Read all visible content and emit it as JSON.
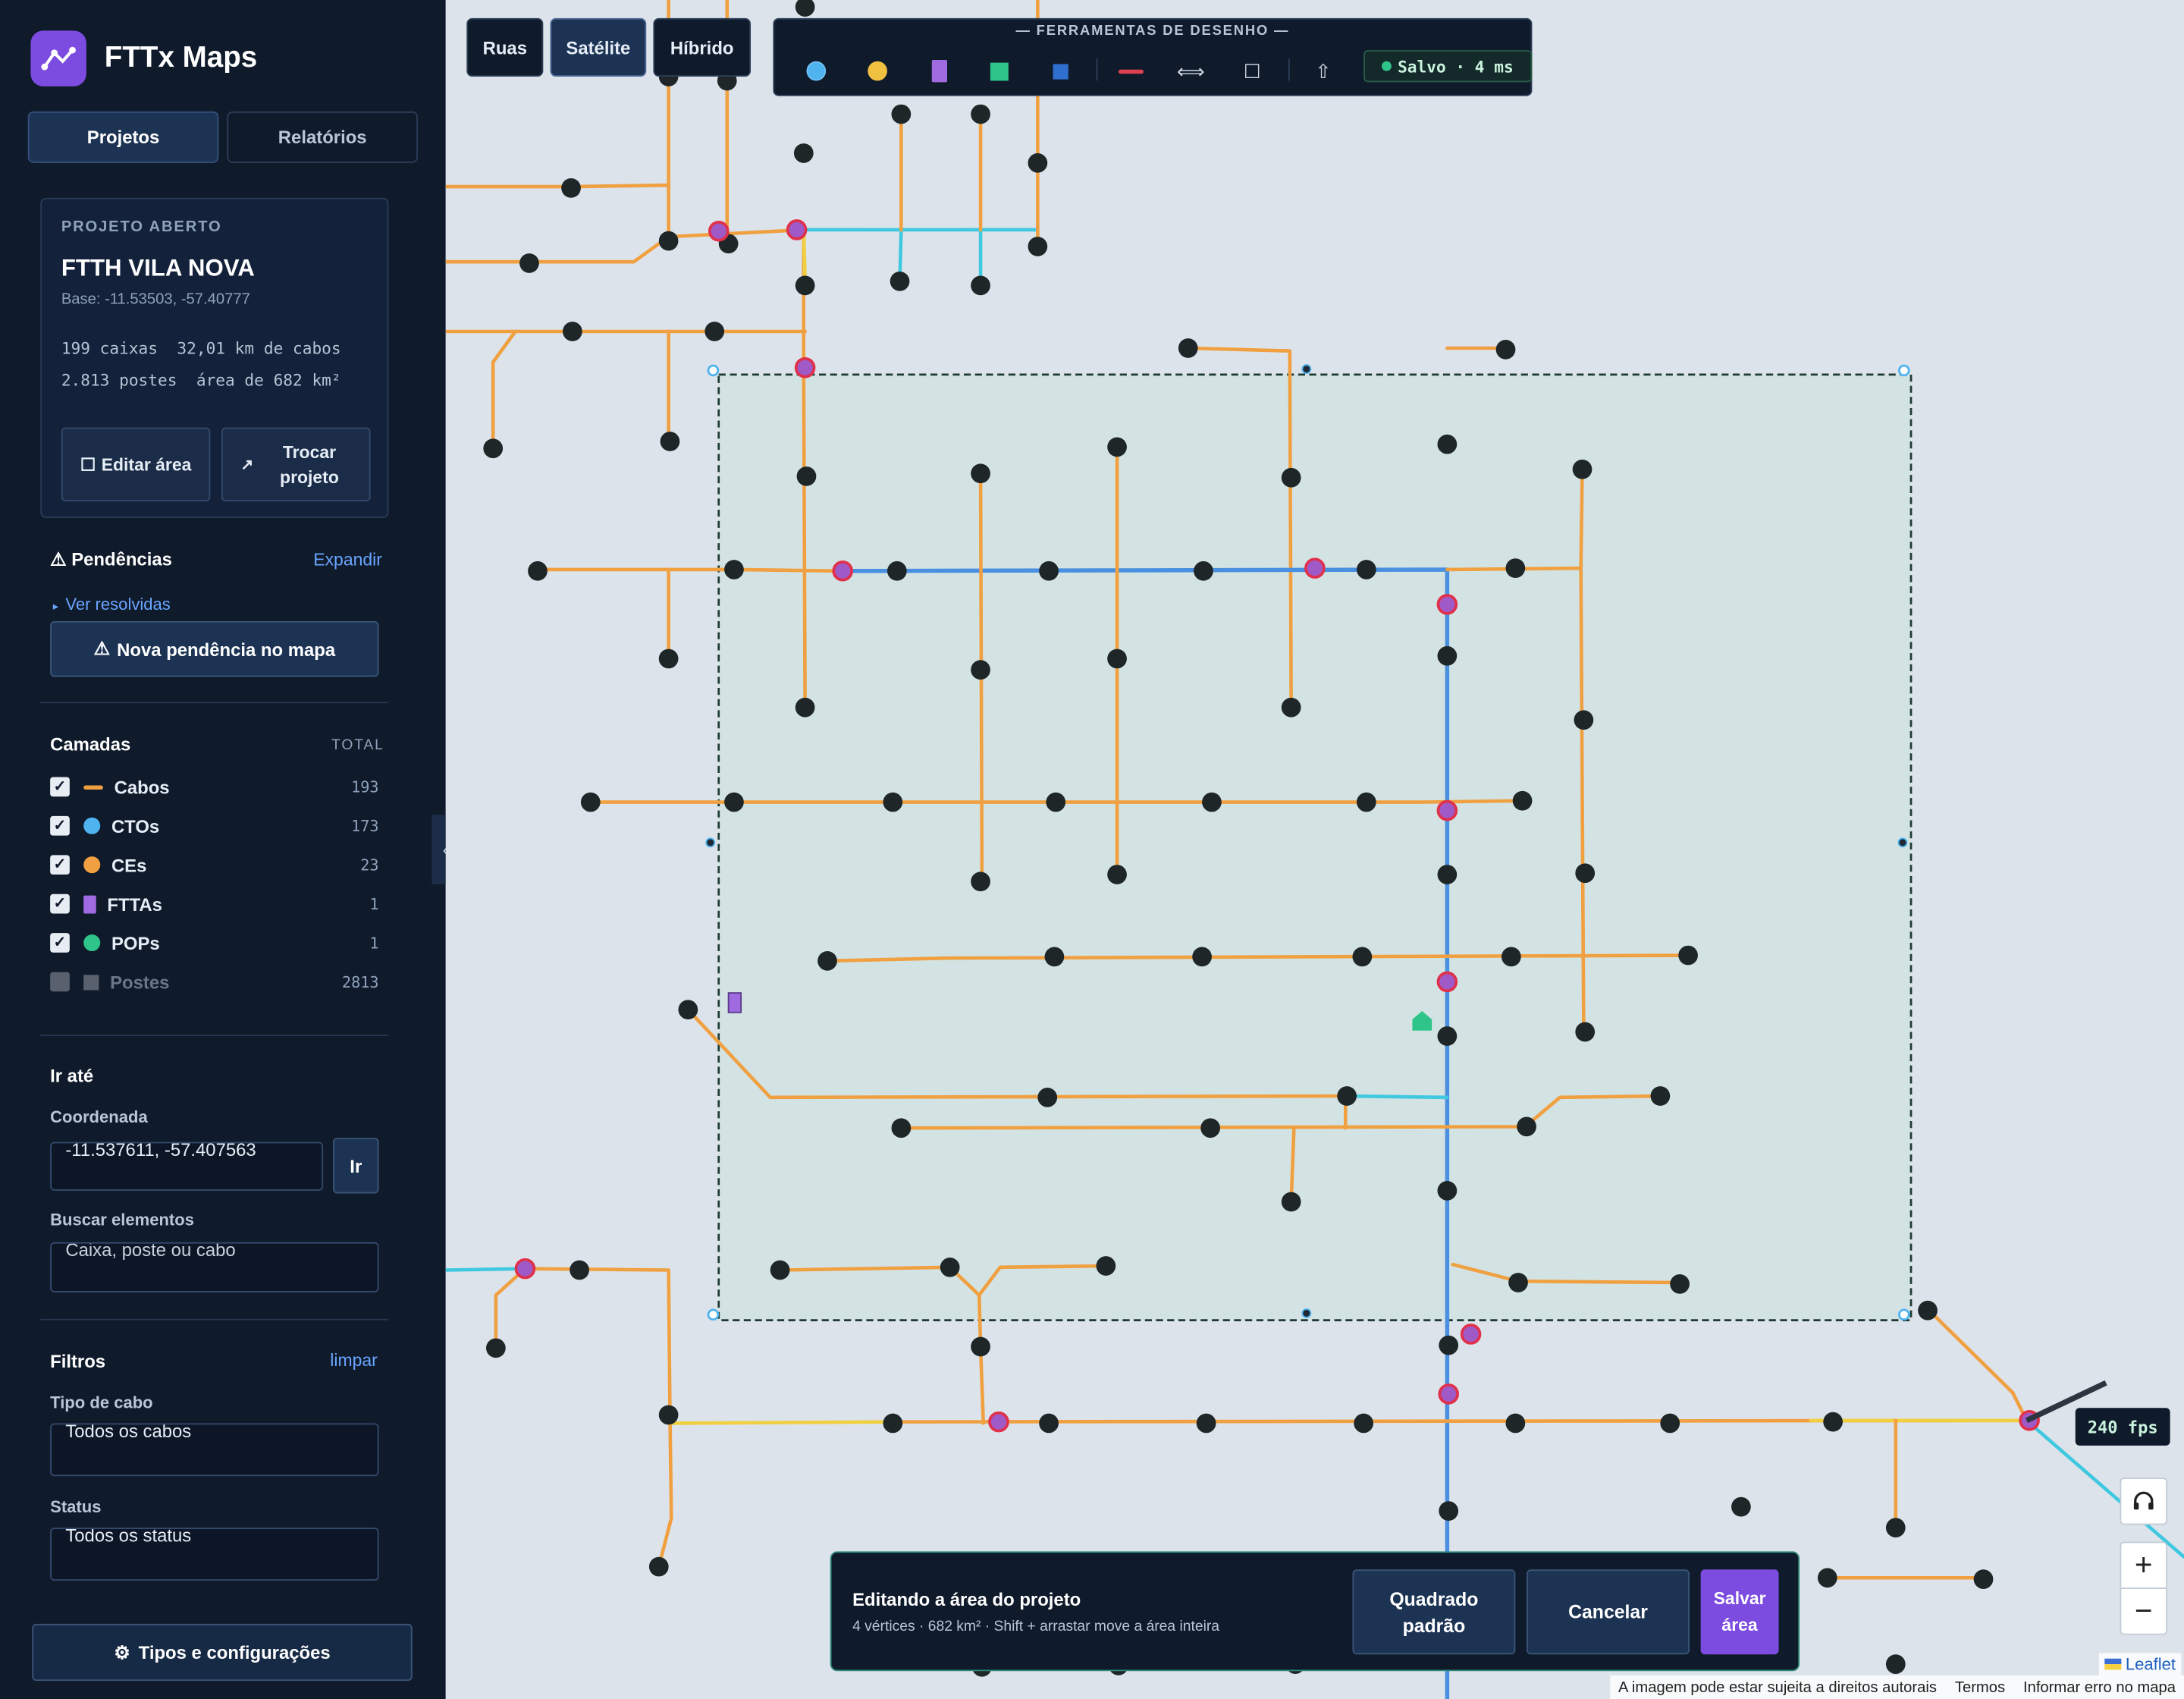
{
  "app": {
    "name": "FTTx Maps"
  },
  "tabs": [
    {
      "label": "Projetos"
    },
    {
      "label": "Relatórios"
    }
  ],
  "project": {
    "kicker": "PROJETO ABERTO",
    "title": "FTTH VILA NOVA",
    "base": "Base: -11.53503, -57.40777",
    "stats_line1": "199 caixas  32,01 km de cabos",
    "stats_line2": "2.813 postes  área de 682 km²",
    "edit_area": "Editar área",
    "swap_project": "Trocar projeto"
  },
  "pendencias": {
    "title": "Pendências",
    "expand": "Expandir",
    "resolved_link": "Ver resolvidas",
    "new_button": "Nova pendência no mapa"
  },
  "layers": {
    "title": "Camadas",
    "total_label": "TOTAL",
    "items": [
      {
        "name": "Cabos",
        "count": "193",
        "checked": true,
        "color": "#f0a040"
      },
      {
        "name": "CTOs",
        "count": "173",
        "checked": true,
        "color": "#4fb3f0"
      },
      {
        "name": "CEs",
        "count": "23",
        "checked": true,
        "color": "#f0a040"
      },
      {
        "name": "FTTAs",
        "count": "1",
        "checked": true,
        "color": "#a06be0"
      },
      {
        "name": "POPs",
        "count": "1",
        "checked": true,
        "color": "#2ec48a"
      },
      {
        "name": "Postes",
        "count": "2813",
        "checked": false,
        "color": "#58616d"
      }
    ]
  },
  "goto": {
    "title": "Ir até",
    "coord_label": "Coordenada",
    "coord_value": "-11.537611, -57.407563",
    "go_button": "Ir",
    "search_label": "Buscar elementos",
    "search_placeholder": "Caixa, poste ou cabo"
  },
  "filters": {
    "title": "Filtros",
    "clear": "limpar",
    "cable_label": "Tipo de cabo",
    "cable_value": "Todos os cabos",
    "status_label": "Status",
    "status_value": "Todos os status"
  },
  "settings_button": "Tipos e configurações",
  "map": {
    "types": [
      {
        "label": "Ruas"
      },
      {
        "label": "Satélite"
      },
      {
        "label": "Híbrido"
      }
    ],
    "active_type": "Satélite",
    "toolbar_title": "FERRAMENTAS DE DESENHO",
    "saved_status": "Salvo · 4 ms",
    "fps": "240 fps",
    "zoom_in": "+",
    "zoom_out": "−"
  },
  "edit_panel": {
    "title": "Editando a área do projeto",
    "subtitle": "4 vértices · 682 km² · Shift + arrastar move a área inteira",
    "default_square": "Quadrado padrão",
    "cancel": "Cancelar",
    "save": "Salvar área"
  },
  "attribution": {
    "leaflet": "Leaflet",
    "copyright": "A imagem pode estar sujeita a direitos autorais",
    "terms": "Termos",
    "report": "Informar erro no mapa"
  },
  "colors": {
    "accent": "#7c4ce0",
    "drop_cable": "#f0a040",
    "backbone": "#4a90e0",
    "feeder": "#40c8e0",
    "trunk": "#f0d040",
    "area_border": "#1f6b5a"
  }
}
